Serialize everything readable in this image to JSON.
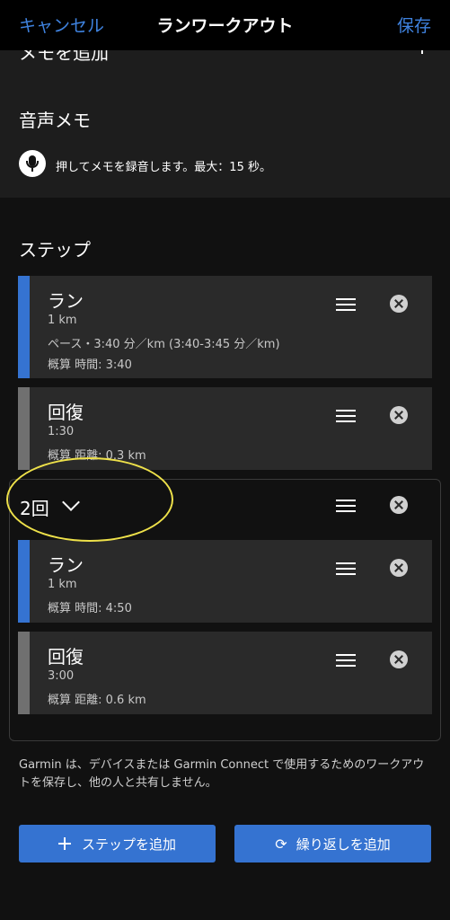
{
  "header": {
    "cancel": "キャンセル",
    "title": "ランワークアウト",
    "save": "保存"
  },
  "memo": {
    "add_label": "メモを追加",
    "voice_title": "音声メモ",
    "voice_hint": "押してメモを録音します。最大：15 秒。"
  },
  "steps": {
    "title": "ステップ",
    "items": [
      {
        "name": "ラン",
        "line1": "1 km",
        "line2": "ペース・3:40 分／km (3:40-3:45 分／km)",
        "line3": "概算 時間: 3:40",
        "color": "#3573d1"
      },
      {
        "name": "回復",
        "line1": "1:30",
        "line2": "概算 距離: 0.3 km",
        "color": "#707070"
      }
    ],
    "repeat": {
      "label": "2回",
      "items": [
        {
          "name": "ラン",
          "line1": "1 km",
          "line2": "概算 時間: 4:50",
          "color": "#3573d1"
        },
        {
          "name": "回復",
          "line1": "3:00",
          "line2": "概算 距離: 0.6 km",
          "color": "#707070"
        }
      ]
    }
  },
  "disclaimer": "Garmin は、デバイスまたは Garmin Connect で使用するためのワークアウトを保存し、他の人と共有しません。",
  "buttons": {
    "add_step": "ステップを追加",
    "add_repeat": "繰り返しを追加"
  },
  "colors": {
    "accent": "#3f83e0",
    "button": "#3573d1",
    "run_bar": "#3573d1",
    "recovery_bar": "#707070",
    "highlight": "#eee14a"
  }
}
